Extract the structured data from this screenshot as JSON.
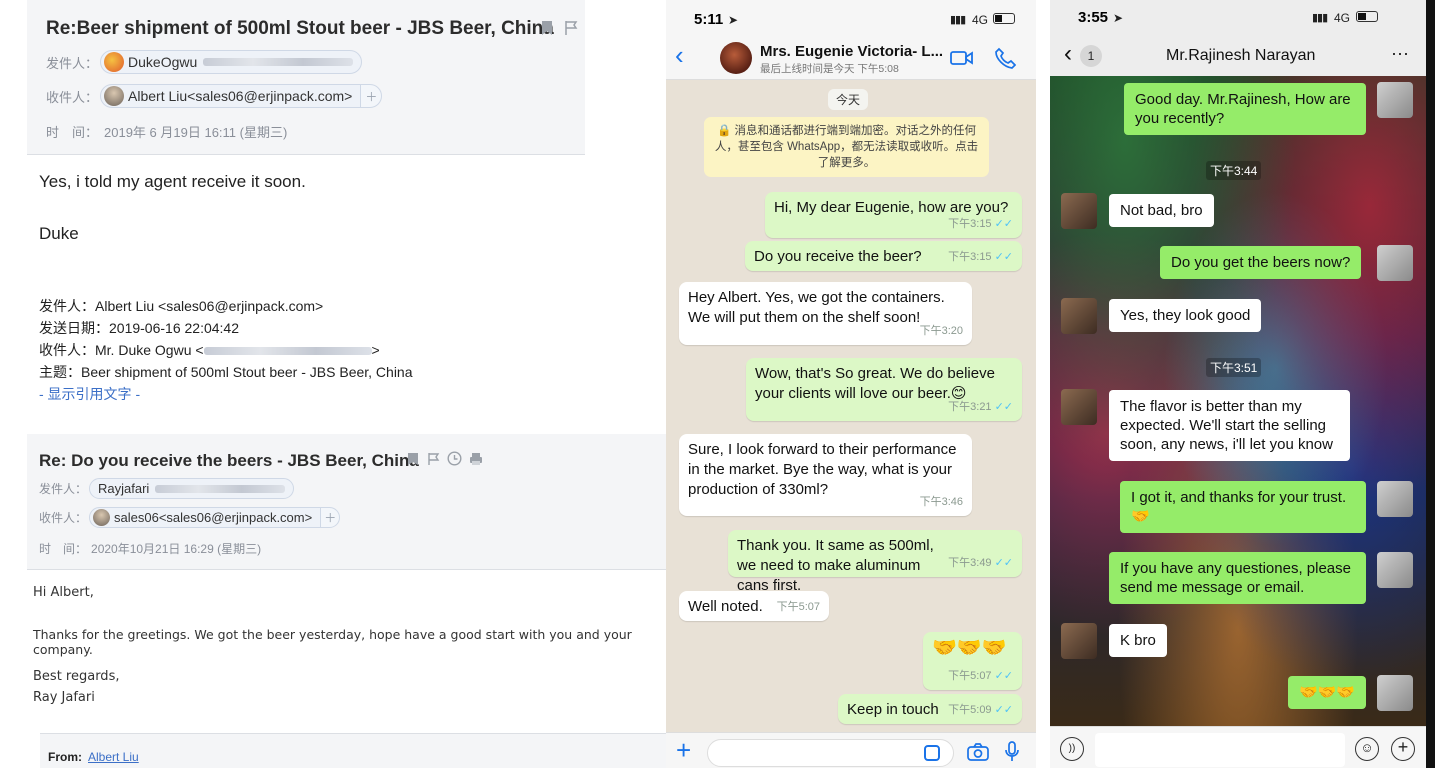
{
  "email1": {
    "subject": "Re:Beer shipment of 500ml Stout beer - JBS Beer, China",
    "from_label": "发件人：",
    "from_name": "DukeOgwu",
    "to_label": "收件人：",
    "to_name": "Albert Liu<sales06@erjinpack.com>",
    "time_label": "时　间：",
    "time_value": "2019年 6 月19日 16:11 (星期三)",
    "body_line1": "Yes, i told my agent receive it soon.",
    "body_line2": "Duke",
    "quoted": {
      "from": "发件人：Albert Liu <sales06@erjinpack.com>",
      "date": "发送日期：2019-06-16 22:04:42",
      "to_prefix": "收件人：Mr. Duke Ogwu <",
      "to_suffix": ">",
      "subject": "主题：Beer shipment of 500ml Stout beer - JBS Beer, China",
      "show_quote": "- 显示引用文字 -"
    }
  },
  "email2": {
    "subject": "Re: Do you receive the beers - JBS Beer, China",
    "from_label": "发件人：",
    "from_name": "Rayjafari",
    "to_label": "收件人：",
    "to_name": "sales06<sales06@erjinpack.com>",
    "time_label": "时　间：",
    "time_value": "2020年10月21日 16:29 (星期三)",
    "body": [
      "Hi Albert,",
      "Thanks for the greetings. We got the beer yesterday, hope have a good start with you and your company.",
      "Best regards,",
      "Ray Jafari"
    ],
    "footer_from_label": "From:",
    "footer_from_name": "Albert Liu"
  },
  "whatsapp": {
    "status_time": "5:11",
    "signal": "4G",
    "contact_name": "Mrs. Eugenie Victoria- L...",
    "last_seen": "最后上线时间是今天 下午5:08",
    "date_chip": "今天",
    "encryption_notice": "消息和通话都进行端到端加密。对话之外的任何人，甚至包含 WhatsApp，都无法读取或收听。点击了解更多。",
    "messages": [
      {
        "dir": "out",
        "text": "Hi, My dear Eugenie, how are you?",
        "time": "下午3:15"
      },
      {
        "dir": "out",
        "text": "Do you receive the beer?",
        "time": "下午3:15"
      },
      {
        "dir": "in",
        "text": "Hey Albert. Yes, we got the containers. We will put them on the shelf soon!",
        "time": "下午3:20"
      },
      {
        "dir": "out",
        "text": "Wow, that's So great. We do believe your clients will love our beer.😊",
        "time": "下午3:21"
      },
      {
        "dir": "in",
        "text": "Sure, I look forward to their performance in the market. Bye the way, what is your production of 330ml?",
        "time": "下午3:46"
      },
      {
        "dir": "out",
        "text": "Thank you. It same as 500ml, we need to make aluminum cans first.",
        "time": "下午3:49"
      },
      {
        "dir": "in",
        "text": "Well noted.",
        "time": "下午5:07"
      },
      {
        "dir": "out",
        "text": "🤝🤝🤝",
        "time": "下午5:07"
      },
      {
        "dir": "out",
        "text": "Keep in touch",
        "time": "下午5:09"
      }
    ]
  },
  "wechat": {
    "status_time": "3:55",
    "signal": "4G",
    "back_count": "1",
    "contact_name": "Mr.Rajinesh Narayan",
    "time1": "下午3:44",
    "time2": "下午3:51",
    "messages": [
      {
        "dir": "out",
        "text": "Good day. Mr.Rajinesh, How are you recently?"
      },
      {
        "dir": "in",
        "text": "Not bad, bro"
      },
      {
        "dir": "out",
        "text": "Do you get the beers now?"
      },
      {
        "dir": "in",
        "text": "Yes, they look good"
      },
      {
        "dir": "in",
        "text": "The flavor is better than my expected. We'll start the selling soon, any news, i'll let you know"
      },
      {
        "dir": "out",
        "text": "I got it, and thanks for your trust. 🤝"
      },
      {
        "dir": "out",
        "text": "If you have any questiones, please send me message or email."
      },
      {
        "dir": "in",
        "text": "K bro"
      },
      {
        "dir": "out",
        "text": "🤝🤝🤝"
      }
    ]
  }
}
